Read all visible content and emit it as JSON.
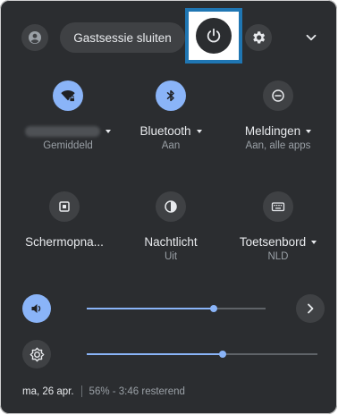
{
  "header": {
    "signout_label": "Gastsessie sluiten",
    "icons": {
      "avatar": "avatar-icon",
      "power": "power-icon",
      "settings": "gear-icon",
      "collapse": "chevron-down-icon"
    }
  },
  "pods": {
    "network": {
      "label": "",
      "sublabel": "Gemiddeld",
      "state": "on",
      "icon": "wifi-lock-icon"
    },
    "bluetooth": {
      "label": "Bluetooth",
      "sublabel": "Aan",
      "state": "on",
      "icon": "bluetooth-icon"
    },
    "notifications": {
      "label": "Meldingen",
      "sublabel": "Aan, alle apps",
      "state": "off",
      "icon": "notifications-icon"
    },
    "screencapture": {
      "label": "Schermopna...",
      "sublabel": "",
      "state": "off",
      "icon": "screen-capture-icon"
    },
    "nightlight": {
      "label": "Nachtlicht",
      "sublabel": "Uit",
      "state": "off",
      "icon": "night-light-icon"
    },
    "keyboard": {
      "label": "Toetsenbord",
      "sublabel": "NLD",
      "state": "off",
      "icon": "keyboard-icon"
    }
  },
  "sliders": {
    "volume": {
      "level_percent": 71,
      "icon": "volume-icon"
    },
    "brightness": {
      "level_percent": 59,
      "icon": "brightness-icon"
    }
  },
  "status": {
    "date": "ma, 26 apr.",
    "battery": "56% - 3:46 resterend"
  },
  "colors": {
    "panel_bg": "#2b2d30",
    "accent": "#8ab4f8",
    "highlight_border": "#1f76b3"
  }
}
